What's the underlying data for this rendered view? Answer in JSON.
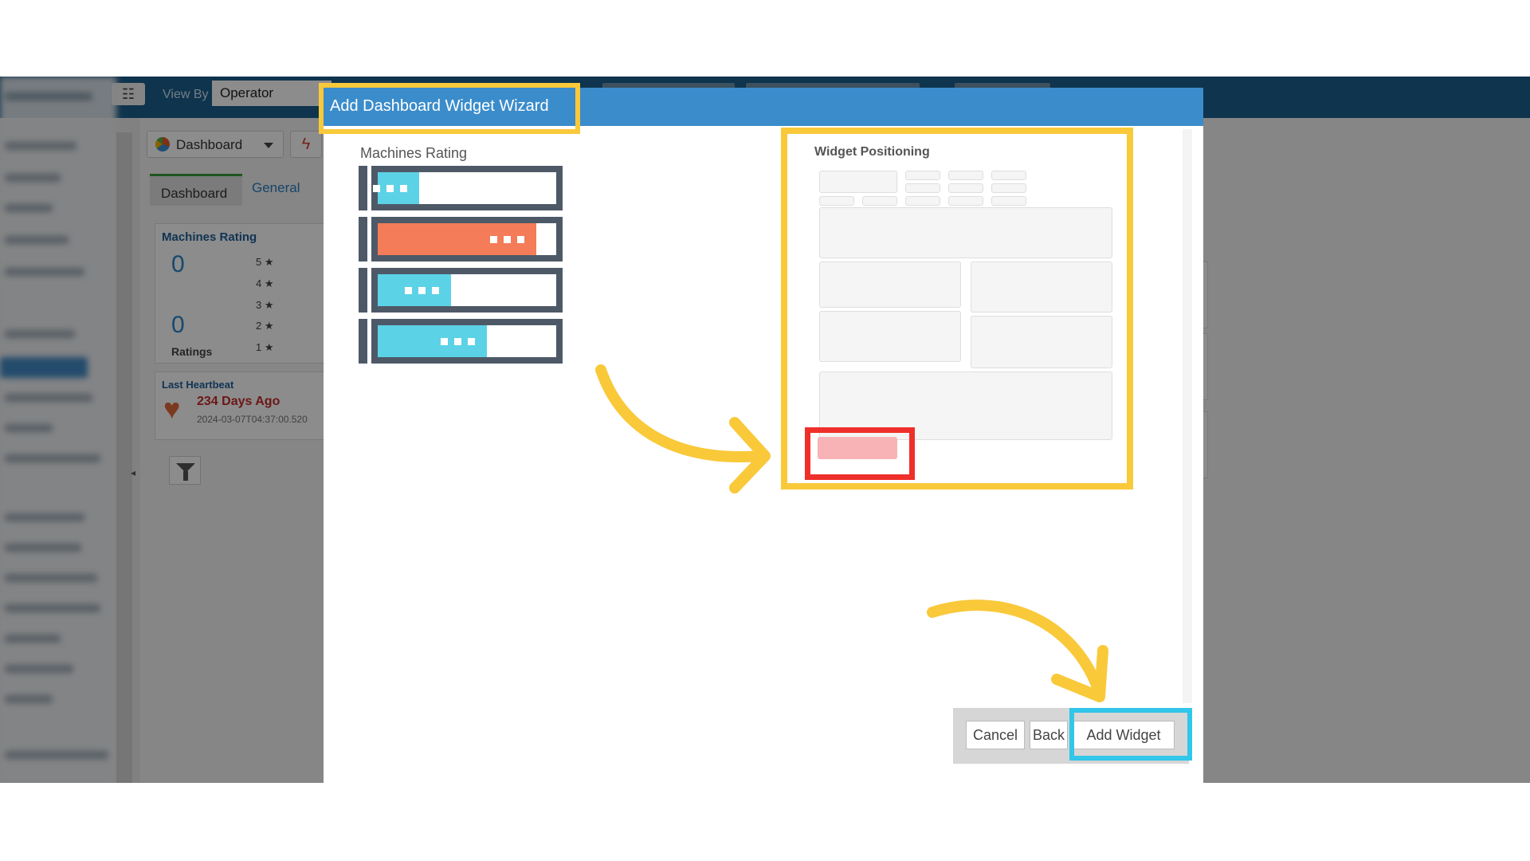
{
  "app": {
    "topbar": {
      "view_by_label": "View By",
      "view_by_value": "Operator"
    },
    "toolbar": {
      "dashboard_button": "Dashboard"
    },
    "tabs": [
      "Dashboard",
      "General"
    ],
    "machines_rating_card": {
      "title": "Machines Rating",
      "count": "0",
      "ratings_count": "0",
      "ratings_label": "Ratings",
      "stars": [
        "5 ★",
        "4 ★",
        "3 ★",
        "2 ★",
        "1 ★"
      ]
    },
    "heartbeat_card": {
      "title": "Last Heartbeat",
      "days": "234 Days Ago",
      "timestamp": "2024-03-07T04:37:00.520"
    }
  },
  "modal": {
    "title": "Add Dashboard Widget Wizard",
    "widget_label": "Machines Rating",
    "bars": [
      {
        "fill_fraction": 0.23,
        "color": "#5cd2e6"
      },
      {
        "fill_fraction": 0.89,
        "color": "#f47c58"
      },
      {
        "fill_fraction": 0.41,
        "color": "#5cd2e6"
      },
      {
        "fill_fraction": 0.61,
        "color": "#5cd2e6"
      }
    ],
    "positioning_title": "Widget Positioning",
    "footer": {
      "cancel": "Cancel",
      "back": "Back",
      "add_widget": "Add Widget"
    }
  },
  "highlight_colors": {
    "yellow": "#f9c93a",
    "red": "#ef2f2a",
    "cyan": "#31c6ea"
  }
}
